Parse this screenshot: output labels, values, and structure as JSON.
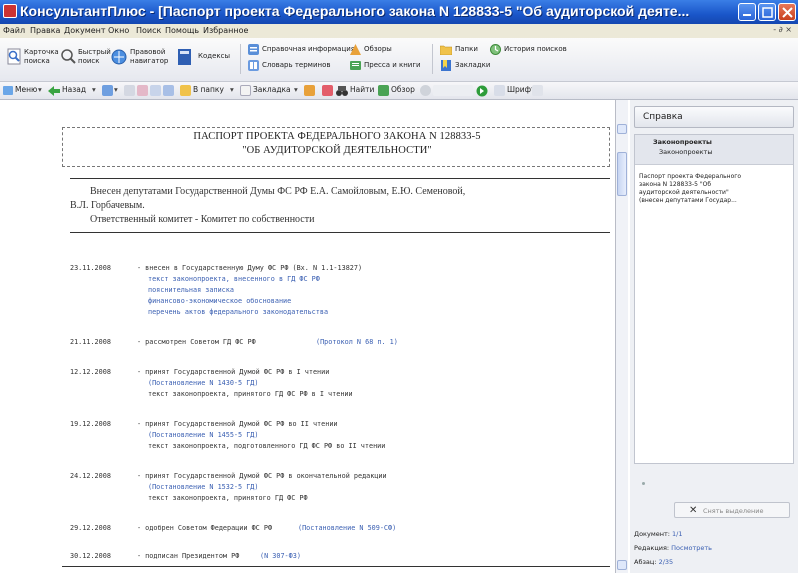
{
  "window": {
    "title": "КонсультантПлюс - [Паспорт проекта Федерального закона N 128833-5 \"Об аудиторской деяте..."
  },
  "menu": {
    "items": [
      "Файл",
      "Правка",
      "Документ",
      "Окно",
      "Поиск",
      "Помощь",
      "Избранное"
    ],
    "mdi_controls": "- ∂ ×"
  },
  "toolbar": {
    "card_search": [
      "Карточка",
      "поиска"
    ],
    "quick_search": [
      "Быстрый",
      "поиск"
    ],
    "legal_navigator": [
      "Правовой",
      "навигатор"
    ],
    "codes": "Кодексы",
    "reference_info": "Справочная информация",
    "dictionary": "Словарь терминов",
    "reviews": "Обзоры",
    "press": "Пресса и книги",
    "folders": "Папки",
    "bookmarks": "Закладки",
    "history": "История поисков"
  },
  "navbar": {
    "menu": "Меню",
    "back": "Назад",
    "to_top": "В папку",
    "bookmark": "Закладка",
    "find": "Найти",
    "review": "Обзор",
    "font": "Шрифт"
  },
  "document": {
    "title_line1": "ПАСПОРТ ПРОЕКТА ФЕДЕРАЛЬНОГО ЗАКОНА N 128833-5",
    "title_line2": "\"ОБ АУДИТОРСКОЙ ДЕЯТЕЛЬНОСТИ\"",
    "authors_line1": "Внесен депутатами Государственной Думы ФС РФ Е.А. Самойловым, Е.Ю. Семеновой,",
    "authors_line2": "В.Л. Горбачевым.",
    "committee": "Ответственный комитет - Комитет по собственности",
    "entries": [
      {
        "date": "23.11.2008",
        "text": "- внесен в Государственную Думу ФС РФ (Вх. N 1.1-13827)",
        "sub": [
          "текст законопроекта, внесенного в ГД ФС РФ",
          "пояснительная записка",
          "финансово-экономическое обоснование",
          "перечень актов федерального законодательства"
        ]
      },
      {
        "date": "21.11.2008",
        "text": "- рассмотрен Советом ГД ФС РФ",
        "link": "(Протокол N 68 п. 1)"
      },
      {
        "date": "12.12.2008",
        "text": "- принят Государственной Думой ФС РФ в I чтении",
        "sub": [
          "(Постановление N 1430-5 ГД)",
          "текст законопроекта, принятого ГД ФС РФ в I чтении"
        ]
      },
      {
        "date": "19.12.2008",
        "text": "- принят Государственной Думой ФС РФ во II чтении",
        "sub": [
          "(Постановление N 1455-5 ГД)",
          "текст законопроекта, подготовленного ГД ФС РФ во II чтении"
        ]
      },
      {
        "date": "24.12.2008",
        "text": "- принят Государственной Думой ФС РФ в окончательной редакции",
        "sub": [
          "(Постановление N 1532-5 ГД)",
          "текст законопроекта, принятого ГД ФС РФ"
        ]
      },
      {
        "date": "29.12.2008",
        "text": "- одобрен Советом Федерации ФС РФ",
        "link": "(Постановление N 509-СФ)"
      },
      {
        "date": "30.12.2008",
        "text": "- подписан Президентом РФ",
        "link": "(N 307-ФЗ)"
      }
    ]
  },
  "right_panel": {
    "header": "Справка",
    "group_title": "Законопроекты",
    "group_subtitle": "Законопроекты",
    "item_lines": [
      "Паспорт проекта Федерального",
      "закона N 128833-5 \"Об",
      "аудиторской деятельности\"",
      "(внесен депутатами Государ..."
    ],
    "button_label": "Снять выделение",
    "doc_label": "Документ:",
    "doc_value": "1/1",
    "edition_label": "Редакция:",
    "edition_value": "Посмотреть",
    "para_label": "Абзац:",
    "para_value": "2/35"
  }
}
